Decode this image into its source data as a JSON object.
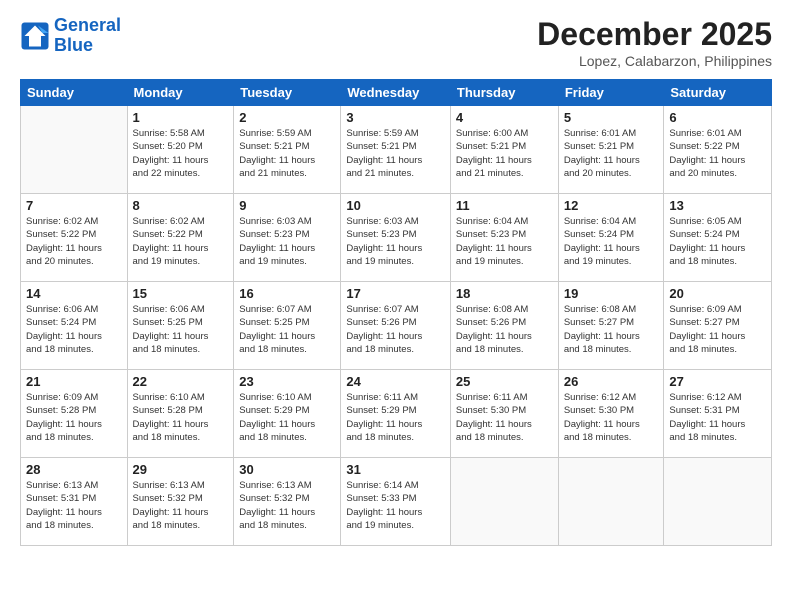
{
  "header": {
    "logo_line1": "General",
    "logo_line2": "Blue",
    "month": "December 2025",
    "location": "Lopez, Calabarzon, Philippines"
  },
  "days_of_week": [
    "Sunday",
    "Monday",
    "Tuesday",
    "Wednesday",
    "Thursday",
    "Friday",
    "Saturday"
  ],
  "weeks": [
    [
      {
        "day": "",
        "info": ""
      },
      {
        "day": "1",
        "info": "Sunrise: 5:58 AM\nSunset: 5:20 PM\nDaylight: 11 hours\nand 22 minutes."
      },
      {
        "day": "2",
        "info": "Sunrise: 5:59 AM\nSunset: 5:21 PM\nDaylight: 11 hours\nand 21 minutes."
      },
      {
        "day": "3",
        "info": "Sunrise: 5:59 AM\nSunset: 5:21 PM\nDaylight: 11 hours\nand 21 minutes."
      },
      {
        "day": "4",
        "info": "Sunrise: 6:00 AM\nSunset: 5:21 PM\nDaylight: 11 hours\nand 21 minutes."
      },
      {
        "day": "5",
        "info": "Sunrise: 6:01 AM\nSunset: 5:21 PM\nDaylight: 11 hours\nand 20 minutes."
      },
      {
        "day": "6",
        "info": "Sunrise: 6:01 AM\nSunset: 5:22 PM\nDaylight: 11 hours\nand 20 minutes."
      }
    ],
    [
      {
        "day": "7",
        "info": "Sunrise: 6:02 AM\nSunset: 5:22 PM\nDaylight: 11 hours\nand 20 minutes."
      },
      {
        "day": "8",
        "info": "Sunrise: 6:02 AM\nSunset: 5:22 PM\nDaylight: 11 hours\nand 19 minutes."
      },
      {
        "day": "9",
        "info": "Sunrise: 6:03 AM\nSunset: 5:23 PM\nDaylight: 11 hours\nand 19 minutes."
      },
      {
        "day": "10",
        "info": "Sunrise: 6:03 AM\nSunset: 5:23 PM\nDaylight: 11 hours\nand 19 minutes."
      },
      {
        "day": "11",
        "info": "Sunrise: 6:04 AM\nSunset: 5:23 PM\nDaylight: 11 hours\nand 19 minutes."
      },
      {
        "day": "12",
        "info": "Sunrise: 6:04 AM\nSunset: 5:24 PM\nDaylight: 11 hours\nand 19 minutes."
      },
      {
        "day": "13",
        "info": "Sunrise: 6:05 AM\nSunset: 5:24 PM\nDaylight: 11 hours\nand 18 minutes."
      }
    ],
    [
      {
        "day": "14",
        "info": "Sunrise: 6:06 AM\nSunset: 5:24 PM\nDaylight: 11 hours\nand 18 minutes."
      },
      {
        "day": "15",
        "info": "Sunrise: 6:06 AM\nSunset: 5:25 PM\nDaylight: 11 hours\nand 18 minutes."
      },
      {
        "day": "16",
        "info": "Sunrise: 6:07 AM\nSunset: 5:25 PM\nDaylight: 11 hours\nand 18 minutes."
      },
      {
        "day": "17",
        "info": "Sunrise: 6:07 AM\nSunset: 5:26 PM\nDaylight: 11 hours\nand 18 minutes."
      },
      {
        "day": "18",
        "info": "Sunrise: 6:08 AM\nSunset: 5:26 PM\nDaylight: 11 hours\nand 18 minutes."
      },
      {
        "day": "19",
        "info": "Sunrise: 6:08 AM\nSunset: 5:27 PM\nDaylight: 11 hours\nand 18 minutes."
      },
      {
        "day": "20",
        "info": "Sunrise: 6:09 AM\nSunset: 5:27 PM\nDaylight: 11 hours\nand 18 minutes."
      }
    ],
    [
      {
        "day": "21",
        "info": "Sunrise: 6:09 AM\nSunset: 5:28 PM\nDaylight: 11 hours\nand 18 minutes."
      },
      {
        "day": "22",
        "info": "Sunrise: 6:10 AM\nSunset: 5:28 PM\nDaylight: 11 hours\nand 18 minutes."
      },
      {
        "day": "23",
        "info": "Sunrise: 6:10 AM\nSunset: 5:29 PM\nDaylight: 11 hours\nand 18 minutes."
      },
      {
        "day": "24",
        "info": "Sunrise: 6:11 AM\nSunset: 5:29 PM\nDaylight: 11 hours\nand 18 minutes."
      },
      {
        "day": "25",
        "info": "Sunrise: 6:11 AM\nSunset: 5:30 PM\nDaylight: 11 hours\nand 18 minutes."
      },
      {
        "day": "26",
        "info": "Sunrise: 6:12 AM\nSunset: 5:30 PM\nDaylight: 11 hours\nand 18 minutes."
      },
      {
        "day": "27",
        "info": "Sunrise: 6:12 AM\nSunset: 5:31 PM\nDaylight: 11 hours\nand 18 minutes."
      }
    ],
    [
      {
        "day": "28",
        "info": "Sunrise: 6:13 AM\nSunset: 5:31 PM\nDaylight: 11 hours\nand 18 minutes."
      },
      {
        "day": "29",
        "info": "Sunrise: 6:13 AM\nSunset: 5:32 PM\nDaylight: 11 hours\nand 18 minutes."
      },
      {
        "day": "30",
        "info": "Sunrise: 6:13 AM\nSunset: 5:32 PM\nDaylight: 11 hours\nand 18 minutes."
      },
      {
        "day": "31",
        "info": "Sunrise: 6:14 AM\nSunset: 5:33 PM\nDaylight: 11 hours\nand 19 minutes."
      },
      {
        "day": "",
        "info": ""
      },
      {
        "day": "",
        "info": ""
      },
      {
        "day": "",
        "info": ""
      }
    ]
  ]
}
